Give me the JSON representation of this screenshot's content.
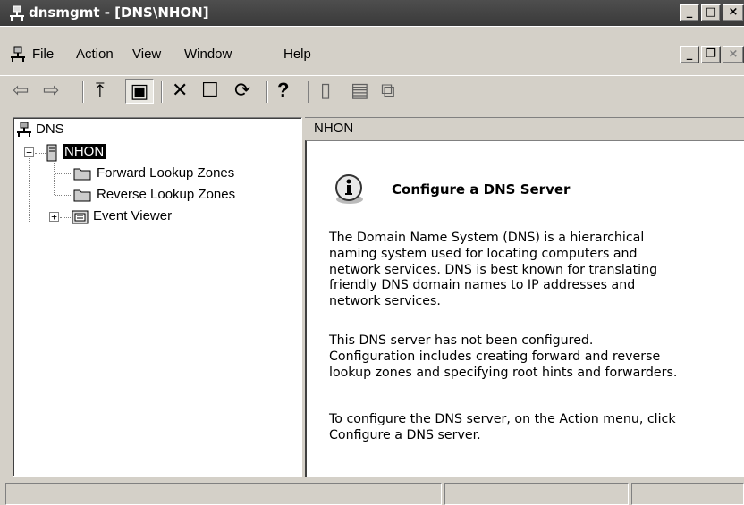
{
  "window": {
    "title": "dnsmgmt - [DNS\\NHON]",
    "controls": {
      "minimize": "_",
      "maximize": "□",
      "close": "×"
    }
  },
  "menubar": {
    "items": [
      "File",
      "Action",
      "View",
      "Window",
      "Help"
    ],
    "mdi_controls": {
      "minimize": "_",
      "restore": "❐",
      "close": "×"
    }
  },
  "toolbar": {
    "buttons": [
      {
        "icon": "back-arrow-icon",
        "glyph": "⇦"
      },
      {
        "icon": "forward-arrow-icon",
        "glyph": "⇨"
      },
      {
        "icon": "up-one-level-icon",
        "glyph": "⤒"
      },
      {
        "icon": "show-hide-tree-icon",
        "glyph": "▣"
      },
      {
        "icon": "delete-icon",
        "glyph": "✕"
      },
      {
        "icon": "properties-icon",
        "glyph": "☐"
      },
      {
        "icon": "refresh-icon",
        "glyph": "⟳"
      },
      {
        "icon": "help-icon",
        "glyph": "?"
      },
      {
        "icon": "server-list-icon",
        "glyph": "▯"
      },
      {
        "icon": "document-icon",
        "glyph": "▤"
      },
      {
        "icon": "export-icon",
        "glyph": "⧉"
      }
    ]
  },
  "tree": {
    "root": "DNS",
    "server": "NHON",
    "children": [
      "Forward Lookup Zones",
      "Reverse Lookup Zones",
      "Event Viewer"
    ]
  },
  "detail": {
    "header": "NHON",
    "heading": "Configure a DNS Server",
    "paragraph1": [
      "The Domain Name System (DNS) is a hierarchical",
      "naming system used for locating computers and",
      "network services. DNS is best known for translating",
      "friendly DNS domain names to IP addresses and",
      "network services."
    ],
    "paragraph2": [
      "This DNS server has not been configured.",
      "Configuration includes creating forward and reverse",
      "lookup zones and specifying root hints and forwarders."
    ],
    "paragraph3": [
      "To configure the DNS server, on the Action menu, click",
      "Configure a DNS server."
    ]
  },
  "colors": {
    "titlebar": "#3a3a3a",
    "chrome": "#d4d0c8",
    "pane": "#ffffff",
    "selection": "#000000"
  }
}
